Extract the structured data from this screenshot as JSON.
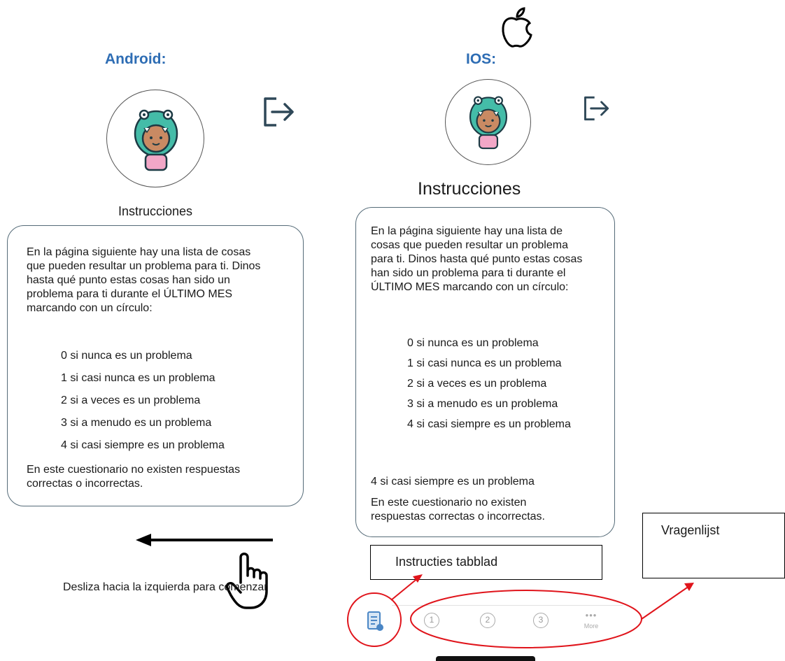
{
  "android": {
    "platform_label": "Android:",
    "title": "Instrucciones",
    "intro": "En la página siguiente hay una lista de cosas que pueden resultar un problema para ti. Dinos hasta qué punto estas cosas han sido un problema para ti durante el ÚLTIMO MES marcando con un círculo:",
    "scale": [
      "0 si nunca es un problema",
      "1 si casi nunca es un problema",
      "2 si a veces es un problema",
      "3 si a menudo es un problema",
      "4 si casi siempre es un problema"
    ],
    "footer": "En este cuestionario no existen respuestas correctas o incorrectas.",
    "swipe_hint": "Desliza hacia la izquierda para comenzar"
  },
  "ios": {
    "platform_label": "IOS:",
    "title": "Instrucciones",
    "intro": "En la página siguiente hay una lista de cosas que pueden resultar un problema para ti. Dinos hasta qué punto estas cosas han sido un problema para ti durante el ÚLTIMO MES marcando con un círculo:",
    "scale": [
      "0 si nunca es un problema",
      "1 si casi nunca es un problema",
      "2 si a veces es un problema",
      "3 si a menudo es un problema",
      "4 si casi siempre es un problema"
    ],
    "extra_line": "4 si casi siempre es un problema",
    "footer": "En este cuestionario no existen respuestas correctas o incorrectas.",
    "tabs": [
      "1",
      "2",
      "3"
    ],
    "more_label": "More"
  },
  "annotations": {
    "instructions_tab": "Instructies tabblad",
    "questionnaire": "Vragenlijst"
  },
  "colors": {
    "platform_label": "#2e6db4",
    "annotation_red": "#e0141b",
    "card_border": "#556b78",
    "logout_icon": "#2f4858"
  },
  "icons": {
    "logout": "logout-icon",
    "avatar": "dino-avatar-icon",
    "apple": "apple-logo-icon",
    "instructions_tab": "document-icon",
    "swipe_hand": "pointing-hand-icon"
  }
}
